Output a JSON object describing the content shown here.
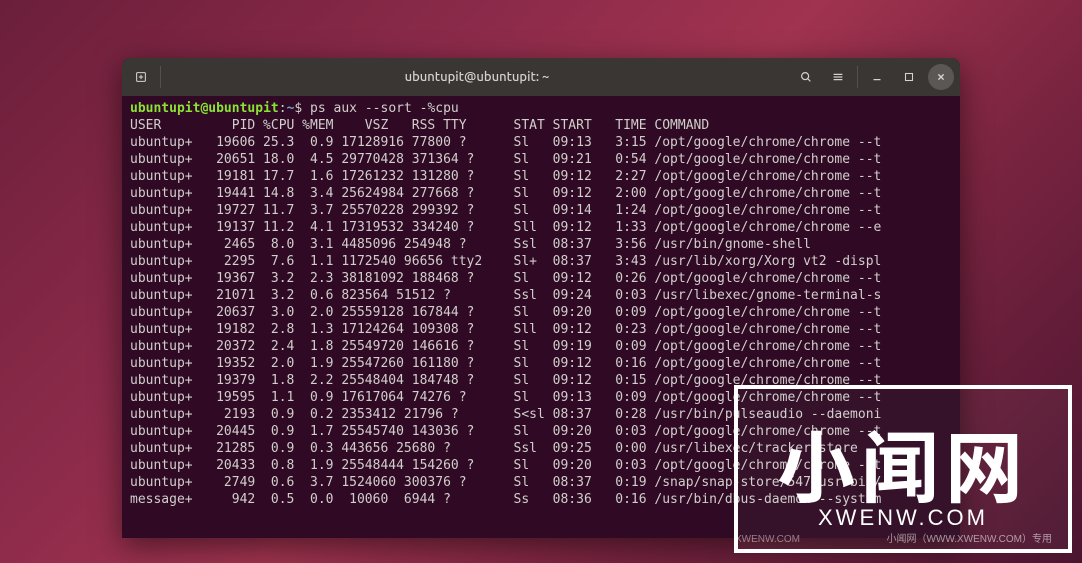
{
  "titlebar": {
    "title": "ubuntupit@ubuntupit: ~"
  },
  "prompt": {
    "user": "ubuntupit",
    "at": "@",
    "host": "ubuntupit",
    "colon": ":",
    "path": "~",
    "dollar": "$",
    "command": "ps aux --sort -%cpu"
  },
  "header": "USER         PID %CPU %MEM    VSZ   RSS TTY      STAT START   TIME COMMAND",
  "rows": [
    "ubuntup+   19606 25.3  0.9 17128916 77800 ?      Sl   09:13   3:15 /opt/google/chrome/chrome --t",
    "ubuntup+   20651 18.0  4.5 29770428 371364 ?     Sl   09:21   0:54 /opt/google/chrome/chrome --t",
    "ubuntup+   19181 17.7  1.6 17261232 131280 ?     Sl   09:12   2:27 /opt/google/chrome/chrome --t",
    "ubuntup+   19441 14.8  3.4 25624984 277668 ?     Sl   09:12   2:00 /opt/google/chrome/chrome --t",
    "ubuntup+   19727 11.7  3.7 25570228 299392 ?     Sl   09:14   1:24 /opt/google/chrome/chrome --t",
    "ubuntup+   19137 11.2  4.1 17319532 334240 ?     Sll  09:12   1:33 /opt/google/chrome/chrome --e",
    "ubuntup+    2465  8.0  3.1 4485096 254948 ?      Ssl  08:37   3:56 /usr/bin/gnome-shell",
    "ubuntup+    2295  7.6  1.1 1172540 96656 tty2    Sl+  08:37   3:43 /usr/lib/xorg/Xorg vt2 -displ",
    "ubuntup+   19367  3.2  2.3 38181092 188468 ?     Sl   09:12   0:26 /opt/google/chrome/chrome --t",
    "ubuntup+   21071  3.2  0.6 823564 51512 ?        Ssl  09:24   0:03 /usr/libexec/gnome-terminal-s",
    "ubuntup+   20637  3.0  2.0 25559128 167844 ?     Sl   09:20   0:09 /opt/google/chrome/chrome --t",
    "ubuntup+   19182  2.8  1.3 17124264 109308 ?     Sll  09:12   0:23 /opt/google/chrome/chrome --t",
    "ubuntup+   20372  2.4  1.8 25549720 146616 ?     Sl   09:19   0:09 /opt/google/chrome/chrome --t",
    "ubuntup+   19352  2.0  1.9 25547260 161180 ?     Sl   09:12   0:16 /opt/google/chrome/chrome --t",
    "ubuntup+   19379  1.8  2.2 25548404 184748 ?     Sl   09:12   0:15 /opt/google/chrome/chrome --t",
    "ubuntup+   19595  1.1  0.9 17617064 74276 ?      Sl   09:13   0:09 /opt/google/chrome/chrome --t",
    "ubuntup+    2193  0.9  0.2 2353412 21796 ?       S<sl 08:37   0:28 /usr/bin/pulseaudio --daemoni",
    "ubuntup+   20445  0.9  1.7 25545740 143036 ?     Sl   09:20   0:03 /opt/google/chrome/chrome --t",
    "ubuntup+   21285  0.9  0.3 443656 25680 ?        Ssl  09:25   0:00 /usr/libexec/tracker-store",
    "ubuntup+   20433  0.8  1.9 25548444 154260 ?     Sl   09:20   0:03 /opt/google/chrome/chrome --t",
    "ubuntup+    2749  0.6  3.7 1524060 300376 ?      Sl   08:37   0:19 /snap/snap-store/547/usr/bin/",
    "message+     942  0.5  0.0  10060  6944 ?        Ss   08:36   0:16 /usr/bin/dbus-daemon --system"
  ],
  "watermark": {
    "cn": "小闻网",
    "en": "XWENW.COM",
    "small1": "小闻网（WWW.XWENW.COM）专用",
    "small2": "XWENW.COM"
  }
}
